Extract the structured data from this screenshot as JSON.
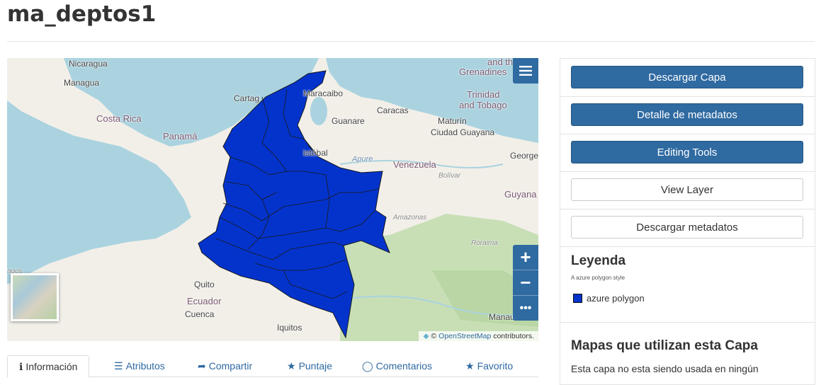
{
  "page": {
    "title": "ma_deptos1"
  },
  "map": {
    "labels": {
      "nicaragua": "Nicaragua",
      "managua": "Managua",
      "costa_rica": "Costa Rica",
      "panama": "Panamá",
      "cartagena": "Cartag",
      "maracaibo": "Maracaibo",
      "caracas": "Caracas",
      "guanare": "Guanare",
      "maturin": "Maturín",
      "ciudad_guayana": "Ciudad Guayana",
      "trinidad": "Trinidad",
      "tobago": "and Tobago",
      "grenadines_1": "and the",
      "grenadines_2": "Grenadines",
      "san_cristobal": "istóbal",
      "apure": "Apure",
      "venezuela": "Venezuela",
      "bolivar": "Bolívar",
      "georgetown": "George",
      "guyana": "Guyana",
      "amazonas": "Amazonas",
      "roraima": "Roraima",
      "quito": "Quito",
      "ecuador": "Ecuador",
      "cuenca": "Cuenca",
      "iquitos": "Iquitos",
      "manaus": "Manau",
      "galapagos": "agos"
    },
    "attribution": {
      "prefix": "©",
      "link": "OpenStreetMap",
      "suffix": "contributors."
    },
    "zoom": {
      "in": "+",
      "out": "−",
      "more": "•••"
    }
  },
  "tabs": [
    {
      "label": "Información",
      "icon": "info-icon"
    },
    {
      "label": "Atributos",
      "icon": "list-icon"
    },
    {
      "label": "Compartir",
      "icon": "share-icon"
    },
    {
      "label": "Puntaje",
      "icon": "star-icon"
    },
    {
      "label": "Comentarios",
      "icon": "comment-icon"
    },
    {
      "label": "Favorito",
      "icon": "star-icon"
    }
  ],
  "panel": {
    "buttons": {
      "download_layer": "Descargar Capa",
      "metadata_detail": "Detalle de metadatos",
      "editing_tools": "Editing Tools",
      "view_layer": "View Layer",
      "download_metadata": "Descargar metadatos"
    },
    "legend": {
      "title": "Leyenda",
      "subtitle": "A azure polygon style",
      "item": "azure polygon",
      "swatch_color": "#0433cc"
    },
    "maps": {
      "title": "Mapas que utilizan esta Capa",
      "text": "Esta capa no esta siendo usada en ningún"
    }
  },
  "colors": {
    "accent": "#2f6aa1",
    "polygon": "#0433cc",
    "water": "#aad3df"
  }
}
